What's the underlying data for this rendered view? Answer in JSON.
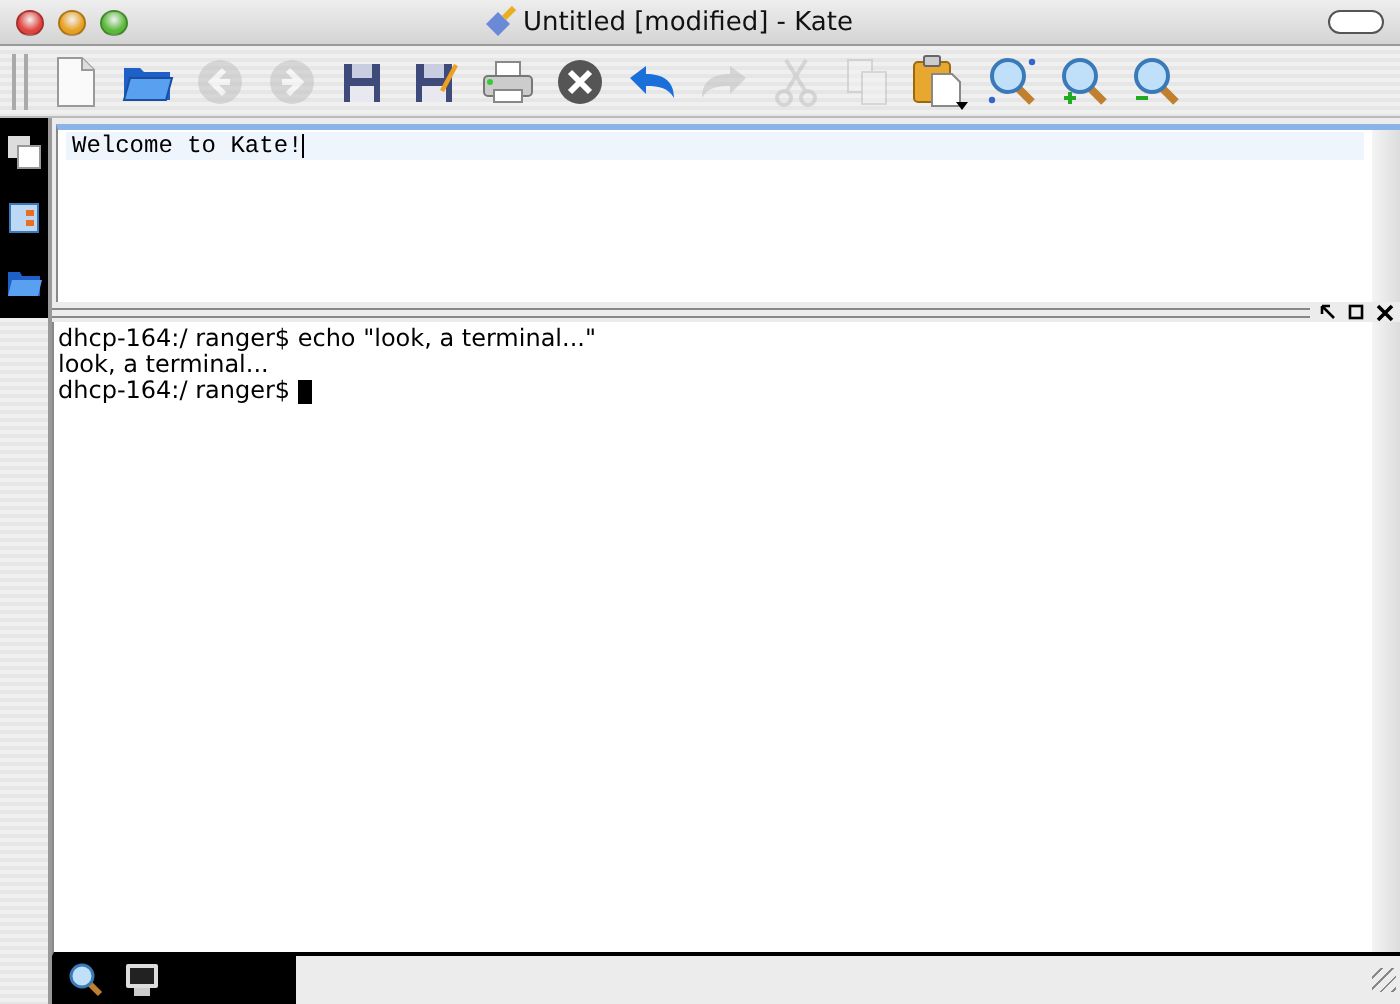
{
  "window": {
    "title": "Untitled [modified] - Kate"
  },
  "toolbar": [
    {
      "kind": "new",
      "disabled": false
    },
    {
      "kind": "open",
      "disabled": false
    },
    {
      "kind": "back",
      "disabled": true
    },
    {
      "kind": "forward",
      "disabled": true
    },
    {
      "kind": "save",
      "disabled": false
    },
    {
      "kind": "save-as",
      "disabled": false
    },
    {
      "kind": "print",
      "disabled": false
    },
    {
      "kind": "close",
      "disabled": false
    },
    {
      "kind": "undo",
      "disabled": false
    },
    {
      "kind": "redo",
      "disabled": true
    },
    {
      "kind": "cut",
      "disabled": true
    },
    {
      "kind": "copy",
      "disabled": true
    },
    {
      "kind": "paste",
      "disabled": false
    },
    {
      "kind": "find",
      "disabled": false
    },
    {
      "kind": "zoom-in",
      "disabled": false
    },
    {
      "kind": "zoom-out",
      "disabled": false
    }
  ],
  "sidebar": {
    "items": [
      {
        "kind": "documents"
      },
      {
        "kind": "project"
      },
      {
        "kind": "folder"
      }
    ]
  },
  "editor": {
    "text": "Welcome to Kate!"
  },
  "terminal": {
    "lines": [
      "dhcp-164:/ ranger$ echo \"look, a terminal...\"",
      "look, a terminal...",
      "dhcp-164:/ ranger$ "
    ]
  },
  "bottom_tabs": [
    {
      "kind": "search"
    },
    {
      "kind": "terminal"
    }
  ]
}
